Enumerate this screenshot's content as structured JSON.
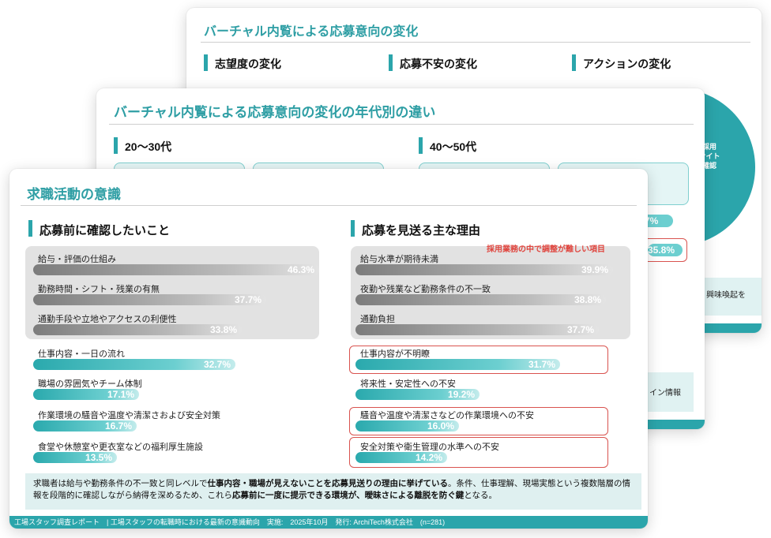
{
  "slide_back": {
    "title": "バーチャル内覧による応募意向の変化",
    "sections": [
      "志望度の変化",
      "応募不安の変化",
      "アクションの変化"
    ],
    "pie_label_lines": [
      "採用",
      "サイト",
      "確認"
    ],
    "side_text": "興味喚起を"
  },
  "slide_mid": {
    "title": "バーチャル内覧による応募意向の変化の年代別の違い",
    "sections": [
      "20〜30代",
      "40〜50代"
    ],
    "pill_values": [
      "7%",
      "35.8%"
    ],
    "side_text": "イン情報"
  },
  "slide_front": {
    "title": "求職活動の意識",
    "left_section": "応募前に確認したいこと",
    "right_section": "応募を見送る主な理由",
    "annotation": "採用業務の中で調整が難しい項目",
    "left_items": [
      {
        "label": "給与・評価の仕組み",
        "value": "46.3%",
        "num": 46.3,
        "style": "g"
      },
      {
        "label": "勤務時間・シフト・残業の有無",
        "value": "37.7%",
        "num": 37.7,
        "style": "g"
      },
      {
        "label": "通勤手段や立地やアクセスの利便性",
        "value": "33.8%",
        "num": 33.8,
        "style": "g"
      },
      {
        "label": "仕事内容・一日の流れ",
        "value": "32.7%",
        "num": 32.7,
        "style": "t"
      },
      {
        "label": "職場の雰囲気やチーム体制",
        "value": "17.1%",
        "num": 17.1,
        "style": "t"
      },
      {
        "label": "作業環境の騒音や温度や清潔さおよび安全対策",
        "value": "16.7%",
        "num": 16.7,
        "style": "t"
      },
      {
        "label": "食堂や休憩室や更衣室などの福利厚生施設",
        "value": "13.5%",
        "num": 13.5,
        "style": "t"
      }
    ],
    "right_items": [
      {
        "label": "給与水準が期待未満",
        "value": "39.9%",
        "num": 39.9,
        "style": "g"
      },
      {
        "label": "夜勤や残業など勤務条件の不一致",
        "value": "38.8%",
        "num": 38.8,
        "style": "g"
      },
      {
        "label": "通勤負担",
        "value": "37.7%",
        "num": 37.7,
        "style": "g"
      },
      {
        "label": "仕事内容が不明瞭",
        "value": "31.7%",
        "num": 31.7,
        "style": "t"
      },
      {
        "label": "将来性・安定性への不安",
        "value": "19.2%",
        "num": 19.2,
        "style": "t"
      },
      {
        "label": "騒音や温度や清潔さなどの作業環境への不安",
        "value": "16.0%",
        "num": 16.0,
        "style": "t"
      },
      {
        "label": "安全対策や衛生管理の水準への不安",
        "value": "14.2%",
        "num": 14.2,
        "style": "t"
      }
    ],
    "summary": {
      "p1": "求職者は給与や勤務条件の不一致と同レベルで",
      "b1": "仕事内容・職場が見えないことを応募見送りの理由に挙げている",
      "p2": "。条件、仕事理解、現場実態という複数階層の情報を段階的に確認しながら納得を深めるため、これら",
      "b2": "応募前に一度に提示できる環境が、曖昧さによる離脱を防ぐ鍵",
      "p3": "となる。"
    },
    "footer": "工場スタッフ調査レポート　| 工場スタッフの転職時における最新の意識動向　実施:　2025年10月　発行: ArchiTech株式会社　(n=281)"
  }
}
